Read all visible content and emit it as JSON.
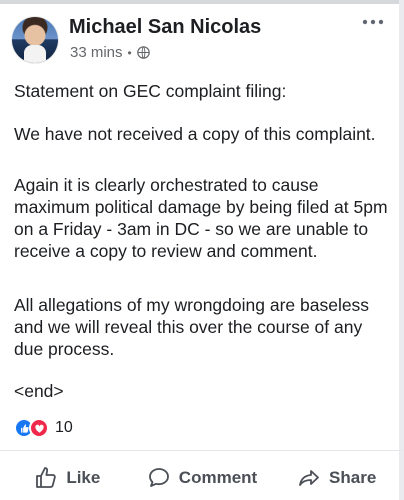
{
  "post": {
    "author": "Michael San Nicolas",
    "time": "33 mins",
    "separator": "•",
    "paragraphs": [
      "Statement on GEC complaint filing:",
      "We have not received a copy of this complaint.",
      "Again it is clearly orchestrated to cause maximum political damage by being filed at 5pm on a Friday - 3am in DC - so we are unable to receive a copy to review and comment.",
      "All allegations of my wrongdoing are baseless and we will reveal this over the course of any due process.",
      "<end>"
    ],
    "reactions_count": "10",
    "reaction_types": [
      "like-icon",
      "love-icon"
    ]
  },
  "actions": {
    "like": "Like",
    "comment": "Comment",
    "share": "Share"
  },
  "colors": {
    "like_blue": "#1877f2",
    "love_red": "#f0284a",
    "text_dark": "#1c1e21",
    "text_secondary": "#65676b"
  }
}
